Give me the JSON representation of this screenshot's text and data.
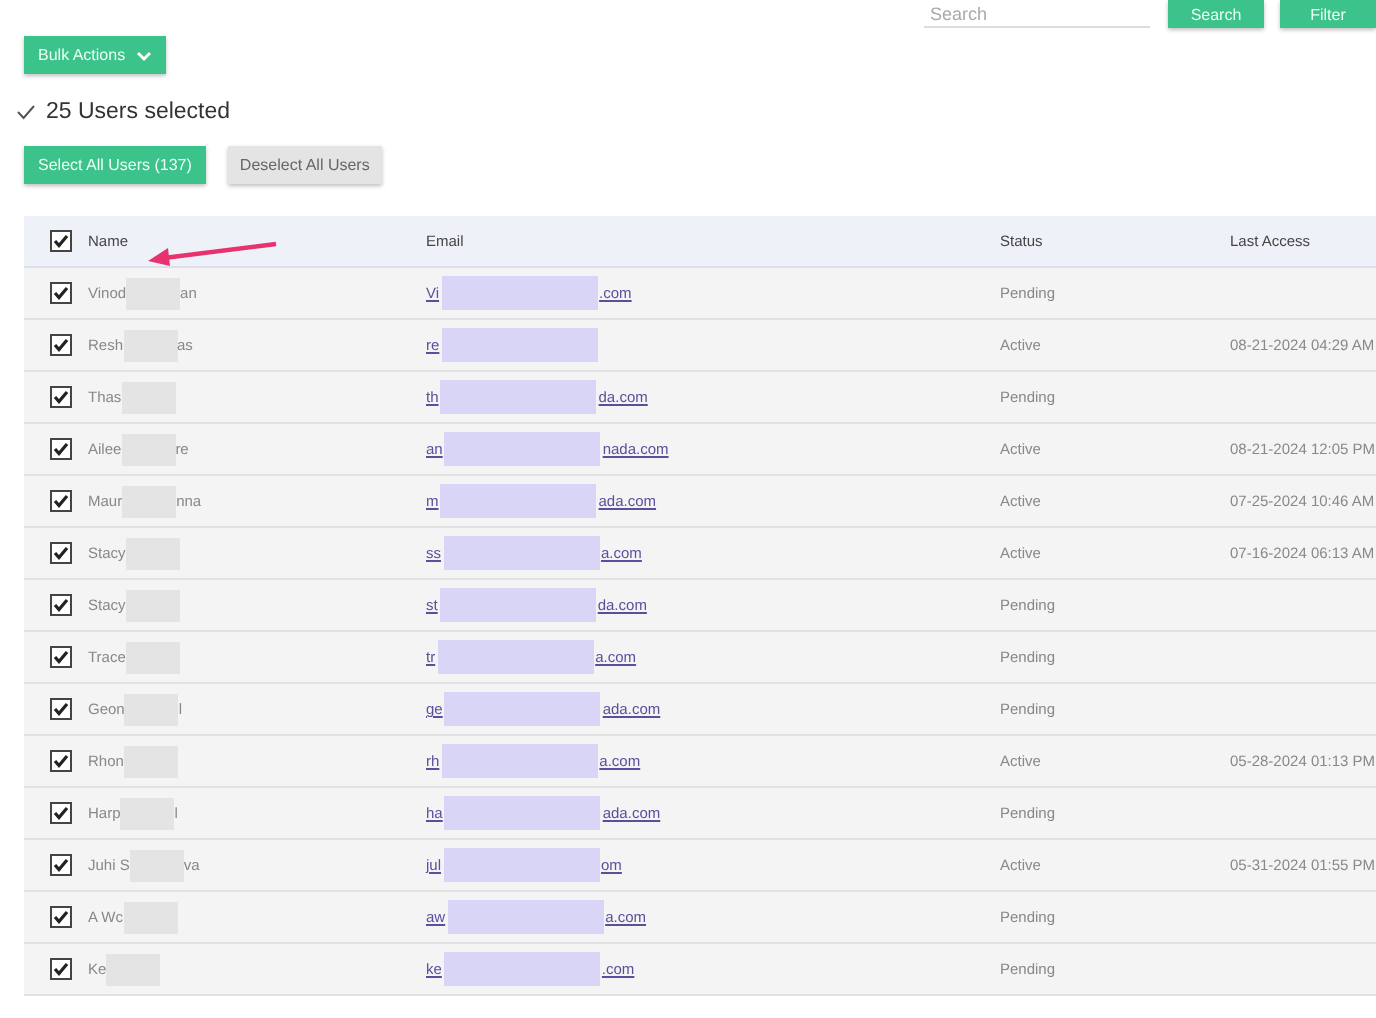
{
  "search": {
    "placeholder": "Search"
  },
  "top_buttons": [
    {
      "label": "Search"
    },
    {
      "label": "Filter"
    }
  ],
  "bulk_actions": {
    "label": "Bulk Actions"
  },
  "selection": {
    "text": "25 Users selected"
  },
  "select_all": {
    "label": "Select All Users (137)"
  },
  "deselect_all": {
    "label": "Deselect All Users"
  },
  "table": {
    "header_checked": true,
    "columns": [
      "Name",
      "Email",
      "Status",
      "Last Access"
    ],
    "rows": [
      {
        "checked": true,
        "name_start": "Vinod",
        "name_end": "an",
        "email_start": "Vi",
        "email_end": ".com",
        "status": "Pending"
      },
      {
        "checked": true,
        "name_start": "Resh",
        "name_end": "as",
        "email_start": "re",
        "status": "Active",
        "last_access": "08-21-2024 04:29 AM"
      },
      {
        "checked": true,
        "name_start": "Thas",
        "email_start": "th",
        "email_end": "da.com",
        "status": "Pending"
      },
      {
        "checked": true,
        "name_start": "Ailee",
        "name_end": "re",
        "email_start": "an",
        "email_end": "nada.com",
        "status": "Active",
        "last_access": "08-21-2024 12:05 PM"
      },
      {
        "checked": true,
        "name_start": "Maur",
        "name_end": "nna",
        "email_start": "m",
        "email_end": "ada.com",
        "status": "Active",
        "last_access": "07-25-2024 10:46 AM"
      },
      {
        "checked": true,
        "name_start": "Stacy",
        "email_start": "ss",
        "email_end": "a.com",
        "status": "Active",
        "last_access": "07-16-2024 06:13 AM"
      },
      {
        "checked": true,
        "name_start": "Stacy",
        "email_start": "st",
        "email_end": "da.com",
        "status": "Pending"
      },
      {
        "checked": true,
        "name_start": "Trace",
        "email_start": "tr",
        "email_end": "a.com",
        "status": "Pending"
      },
      {
        "checked": true,
        "name_start": "Geon",
        "name_end": "l",
        "email_start": "ge",
        "email_end": "ada.com",
        "status": "Pending"
      },
      {
        "checked": true,
        "name_start": "Rhon",
        "email_start": "rh",
        "email_end": "a.com",
        "status": "Active",
        "last_access": "05-28-2024 01:13 PM"
      },
      {
        "checked": true,
        "name_start": "Harp",
        "name_end": "l",
        "email_start": "ha",
        "email_end": "ada.com",
        "status": "Pending"
      },
      {
        "checked": true,
        "name_start": "Juhi S",
        "name_end": "va",
        "email_start": "jul",
        "email_end": "om",
        "status": "Active",
        "last_access": "05-31-2024 01:55 PM"
      },
      {
        "checked": true,
        "name_start": "A Wc",
        "email_start": "aw",
        "email_end": "a.com",
        "status": "Pending"
      },
      {
        "checked": true,
        "name_start": "Ke",
        "email_start": "ke",
        "email_end": ".com",
        "status": "Pending"
      }
    ]
  }
}
